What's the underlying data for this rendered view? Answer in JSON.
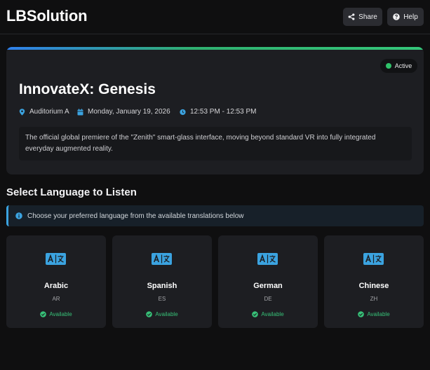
{
  "header": {
    "brand": "LBSolution",
    "share_label": "Share",
    "help_label": "Help"
  },
  "event": {
    "status": "Active",
    "title": "InnovateX: Genesis",
    "location": "Auditorium A",
    "date": "Monday, January 19, 2026",
    "time": "12:53 PM - 12:53 PM",
    "description": "The official global premiere of the \"Zenith\" smart-glass interface, moving beyond standard VR into fully integrated everyday augmented reality."
  },
  "languages_section": {
    "title": "Select Language to Listen",
    "info": "Choose your preferred language from the available translations below",
    "items": [
      {
        "name": "Arabic",
        "code": "AR",
        "status": "Available"
      },
      {
        "name": "Spanish",
        "code": "ES",
        "status": "Available"
      },
      {
        "name": "German",
        "code": "DE",
        "status": "Available"
      },
      {
        "name": "Chinese",
        "code": "ZH",
        "status": "Available"
      }
    ]
  },
  "colors": {
    "background": "#0f0f10",
    "card": "#1d1e22",
    "accent_blue": "#3ba3e0",
    "available_green": "#37c178",
    "active_dot": "#2fc26a"
  },
  "icons": {
    "share": "share-icon",
    "help": "help-icon",
    "location": "map-pin-icon",
    "date": "calendar-icon",
    "time": "clock-icon",
    "info": "info-icon",
    "language": "translate-icon",
    "available": "check-circle-icon"
  }
}
